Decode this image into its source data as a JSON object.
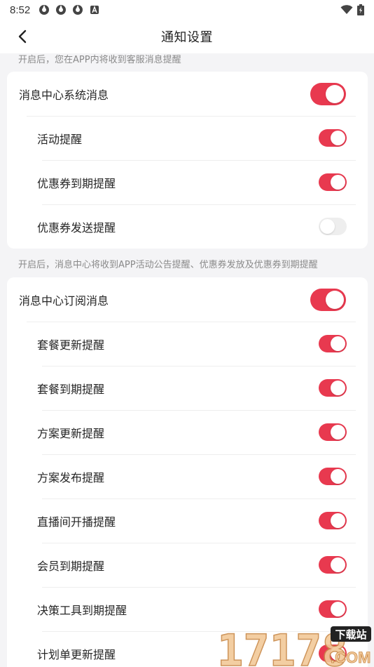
{
  "status_bar": {
    "time": "8:52"
  },
  "header": {
    "title": "通知设置"
  },
  "system_section": {
    "hint": "开启后，您在APP内将收到客服消息提醒",
    "master": {
      "label": "消息中心系统消息",
      "on": true
    },
    "items": [
      {
        "label": "活动提醒",
        "on": true
      },
      {
        "label": "优惠券到期提醒",
        "on": true
      },
      {
        "label": "优惠券发送提醒",
        "on": false
      }
    ]
  },
  "subscription_section": {
    "hint": "开启后，消息中心将收到APP活动公告提醒、优惠券发放及优惠券到期提醒",
    "master": {
      "label": "消息中心订阅消息",
      "on": true
    },
    "items": [
      {
        "label": "套餐更新提醒",
        "on": true
      },
      {
        "label": "套餐到期提醒",
        "on": true
      },
      {
        "label": "方案更新提醒",
        "on": true
      },
      {
        "label": "方案发布提醒",
        "on": true
      },
      {
        "label": "直播间开播提醒",
        "on": true
      },
      {
        "label": "会员到期提醒",
        "on": true
      },
      {
        "label": "决策工具到期提醒",
        "on": true
      },
      {
        "label": "计划单更新提醒",
        "on": true
      }
    ]
  },
  "watermark": {
    "number": "17178",
    "tag": "下载站",
    "domain": ".COM"
  },
  "colors": {
    "accent": "#e8394f",
    "toggle_off": "#eeeeee",
    "background": "#f4f4f6"
  }
}
